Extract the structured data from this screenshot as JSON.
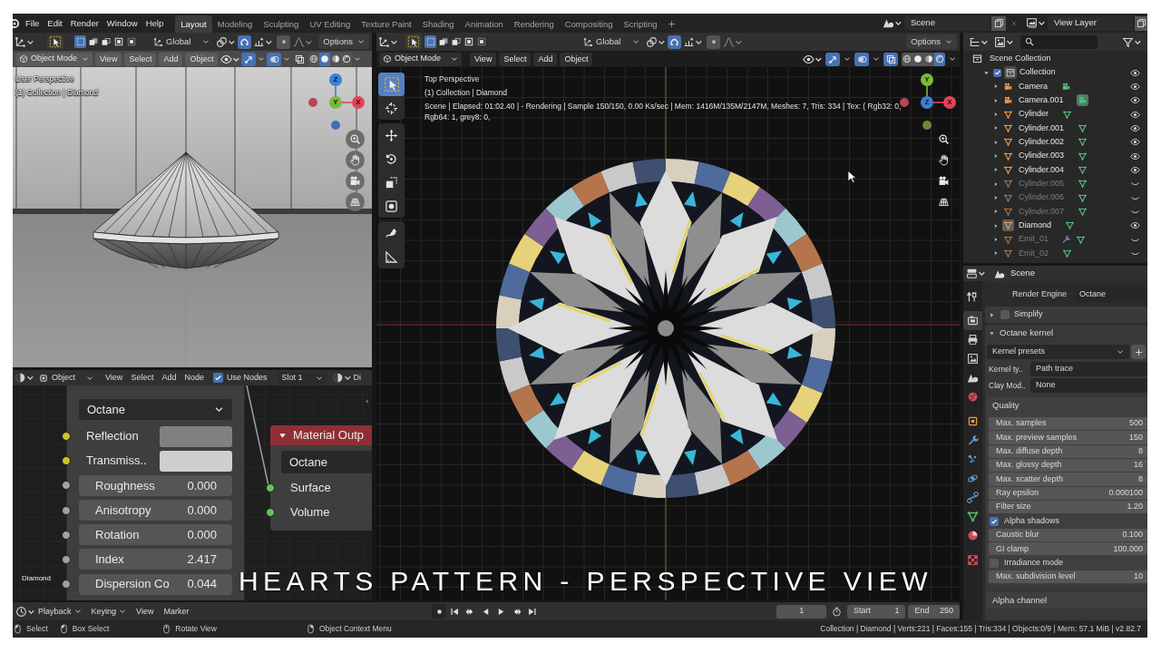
{
  "topbar": {
    "menus": [
      "File",
      "Edit",
      "Render",
      "Window",
      "Help"
    ],
    "workspaces": [
      {
        "label": "Layout",
        "selected": true
      },
      {
        "label": "Modeling",
        "selected": false
      },
      {
        "label": "Sculpting",
        "selected": false
      },
      {
        "label": "UV Editing",
        "selected": false
      },
      {
        "label": "Texture Paint",
        "selected": false
      },
      {
        "label": "Shading",
        "selected": false
      },
      {
        "label": "Animation",
        "selected": false
      },
      {
        "label": "Rendering",
        "selected": false
      },
      {
        "label": "Compositing",
        "selected": false
      },
      {
        "label": "Scripting",
        "selected": false
      }
    ],
    "scene": "Scene",
    "view_layer": "View Layer"
  },
  "left_viewport": {
    "tool_header": {
      "select_modes": [
        {
          "selected": true
        },
        {
          "selected": false
        },
        {
          "selected": false
        },
        {
          "selected": false
        },
        {
          "selected": false
        }
      ],
      "orientation": "Global",
      "snap": true,
      "proportional": false,
      "options": "Options"
    },
    "header": {
      "mode": "Object Mode",
      "menus": [
        "View",
        "Select",
        "Add",
        "Object"
      ],
      "gizmos": true,
      "overlays": true,
      "xray": false,
      "shading": [
        {
          "selected": false
        },
        {
          "selected": true
        },
        {
          "selected": false
        },
        {
          "selected": false
        }
      ]
    },
    "view_name": "User Perspective",
    "collection": "(1) Collection | Diamond",
    "gizmo": [
      {
        "kind": "axis",
        "label": "Z",
        "color": "#3d80d6"
      },
      {
        "kind": "axis",
        "label": "Y",
        "color": "#7cb83a"
      },
      {
        "kind": "axis",
        "label": "X",
        "color": "#e8405a"
      },
      {
        "kind": "dot",
        "color": "#b84458"
      },
      {
        "kind": "dot",
        "color": "#3a70b8"
      }
    ]
  },
  "node_editor": {
    "header": {
      "context": "Object",
      "menus": [
        "View",
        "Select",
        "Add",
        "Node"
      ],
      "use_nodes": {
        "label": "Use Nodes",
        "checked": true
      },
      "slot": "Slot 1",
      "cut_label": "Di"
    },
    "shader_node": {
      "renderer": "Octane",
      "inputs": [
        {
          "kind": "color",
          "label": "Reflection",
          "color": "#808080"
        },
        {
          "kind": "color",
          "label": "Transmiss..",
          "color": "#cfcfcf"
        },
        {
          "kind": "value",
          "label": "Roughness",
          "value": "0.000"
        },
        {
          "kind": "value",
          "label": "Anisotropy",
          "value": "0.000"
        },
        {
          "kind": "value",
          "label": "Rotation",
          "value": "0.000"
        },
        {
          "kind": "value",
          "label": "Index",
          "value": "2.417"
        },
        {
          "kind": "value",
          "label": "Dispersion Co",
          "value": "0.044"
        }
      ]
    },
    "output_node": {
      "title": "Material Outp",
      "target": "Octane",
      "inputs": [
        "Surface",
        "Volume"
      ]
    },
    "material_name": "Diamond"
  },
  "main_viewport": {
    "tool_header": {
      "select_modes": [
        {
          "selected": true
        },
        {
          "selected": false
        },
        {
          "selected": false
        },
        {
          "selected": false
        },
        {
          "selected": false
        }
      ],
      "orientation": "Global",
      "snap": true,
      "proportional": false,
      "options": "Options"
    },
    "header": {
      "mode": "Object Mode",
      "menus": [
        "View",
        "Select",
        "Add",
        "Object"
      ],
      "gizmos": true,
      "overlays": true,
      "xray": true,
      "shading": [
        {
          "selected": false
        },
        {
          "selected": false
        },
        {
          "selected": false
        },
        {
          "selected": true
        }
      ]
    },
    "view_name": "Top Perspective",
    "collection": "(1) Collection | Diamond",
    "render_info": "Scene | Elapsed: 01:02.40 | - Rendering | Sample 150/150, 0.00 Ks/sec | Mem: 1416M/135M/2147M, Meshes: 7, Tris: 334 | Tex: ( Rgb32: 0, Rgb64: 1, grey8: 0,",
    "gizmo": [
      {
        "kind": "axis",
        "label": "Y",
        "color": "#7cb83a"
      },
      {
        "kind": "axis",
        "label": "Z",
        "color": "#3d80d6"
      },
      {
        "kind": "axis",
        "label": "X",
        "color": "#e8405a"
      },
      {
        "kind": "dot",
        "color": "#b84458"
      },
      {
        "kind": "dot",
        "color": "#6a8a3a"
      }
    ]
  },
  "caption": "HEARTS PATTERN - PERSPECTIVE VIEW",
  "timeline": {
    "menus": [
      {
        "label": "Playback",
        "dropdown": true
      },
      {
        "label": "Keying",
        "dropdown": true
      },
      {
        "label": "View",
        "dropdown": false
      },
      {
        "label": "Marker",
        "dropdown": false
      }
    ],
    "current_frame": "1",
    "start": {
      "label": "Start",
      "value": "1"
    },
    "end": {
      "label": "End",
      "value": "250"
    }
  },
  "outliner": {
    "root": "Scene Collection",
    "collections": [
      {
        "name": "Collection",
        "checked": true,
        "expanded": true,
        "visible": true,
        "children": [
          {
            "name": "Camera",
            "kind": "camera",
            "visible": true,
            "active": false,
            "data_selected": false,
            "modifier": false
          },
          {
            "name": "Camera.001",
            "kind": "camera",
            "visible": true,
            "active": false,
            "data_selected": true,
            "modifier": false
          },
          {
            "name": "Cylinder",
            "kind": "mesh",
            "visible": true,
            "active": false,
            "data_selected": false,
            "modifier": false
          },
          {
            "name": "Cylinder.001",
            "kind": "mesh",
            "visible": true,
            "active": false,
            "data_selected": false,
            "modifier": false
          },
          {
            "name": "Cylinder.002",
            "kind": "mesh",
            "visible": true,
            "active": false,
            "data_selected": false,
            "modifier": false
          },
          {
            "name": "Cylinder.003",
            "kind": "mesh",
            "visible": true,
            "active": false,
            "data_selected": false,
            "modifier": false
          },
          {
            "name": "Cylinder.004",
            "kind": "mesh",
            "visible": true,
            "active": false,
            "data_selected": false,
            "modifier": false
          },
          {
            "name": "Cylinder.005",
            "kind": "mesh",
            "visible": false,
            "active": false,
            "data_selected": false,
            "modifier": false
          },
          {
            "name": "Cylinder.006",
            "kind": "mesh",
            "visible": false,
            "active": false,
            "data_selected": false,
            "modifier": false
          },
          {
            "name": "Cylinder.007",
            "kind": "mesh",
            "visible": false,
            "active": false,
            "data_selected": false,
            "modifier": false
          },
          {
            "name": "Diamond",
            "kind": "mesh",
            "visible": true,
            "active": true,
            "data_selected": false,
            "modifier": false
          },
          {
            "name": "Emit_01",
            "kind": "mesh",
            "visible": false,
            "active": false,
            "data_selected": false,
            "modifier": true
          },
          {
            "name": "Emit_02",
            "kind": "mesh",
            "visible": false,
            "active": false,
            "data_selected": false,
            "modifier": false
          }
        ]
      }
    ]
  },
  "properties": {
    "context": "Scene",
    "tabs": [
      {
        "selected": false
      },
      {
        "selected": true
      },
      {
        "selected": false
      },
      {
        "selected": false
      },
      {
        "selected": false
      },
      {
        "selected": false
      },
      {
        "selected": false
      },
      {
        "selected": false
      },
      {
        "selected": false
      },
      {
        "selected": false
      },
      {
        "selected": false
      },
      {
        "selected": false
      },
      {
        "selected": false
      },
      {
        "selected": false
      }
    ],
    "render_engine": {
      "label": "Render Engine",
      "value": "Octane"
    },
    "simplify": {
      "label": "Simplify",
      "expanded": false,
      "checked": false
    },
    "octane_kernel": {
      "title": "Octane kernel",
      "expanded": true,
      "presets": "Kernel presets",
      "fields": [
        {
          "label": "Kernel ty..",
          "value": "Path trace"
        },
        {
          "label": "Clay Mod..",
          "value": "None"
        }
      ],
      "quality": {
        "title": "Quality",
        "rows": [
          {
            "kind": "number",
            "label": "Max. samples",
            "value": "500"
          },
          {
            "kind": "number",
            "label": "Max. preview samples",
            "value": "150"
          },
          {
            "kind": "number",
            "label": "Max. diffuse depth",
            "value": "8"
          },
          {
            "kind": "number",
            "label": "Max. glossy depth",
            "value": "16"
          },
          {
            "kind": "number",
            "label": "Max. scatter depth",
            "value": "8"
          },
          {
            "kind": "number",
            "label": "Ray epsilon",
            "value": "0.000100"
          },
          {
            "kind": "number",
            "label": "Filter size",
            "value": "1.20"
          },
          {
            "kind": "checkbox",
            "label": "Alpha shadows",
            "checked": true
          },
          {
            "kind": "number",
            "label": "Caustic blur",
            "value": "0.100"
          },
          {
            "kind": "number",
            "label": "GI clamp",
            "value": "100.000"
          },
          {
            "kind": "checkbox",
            "label": "Irradiance mode",
            "checked": false
          },
          {
            "kind": "number",
            "label": "Max. subdivision level",
            "value": "10"
          }
        ]
      },
      "alpha_channel": "Alpha channel"
    }
  },
  "status_bar": {
    "hints": [
      "Select",
      "Box Select",
      "Rotate View",
      "Object Context Menu"
    ],
    "stats": "Collection | Diamond | Verts:221 | Faces:155 | Tris:334 | Objects:0/9 | Mem: 57.1 MiB | v2.82.7"
  }
}
